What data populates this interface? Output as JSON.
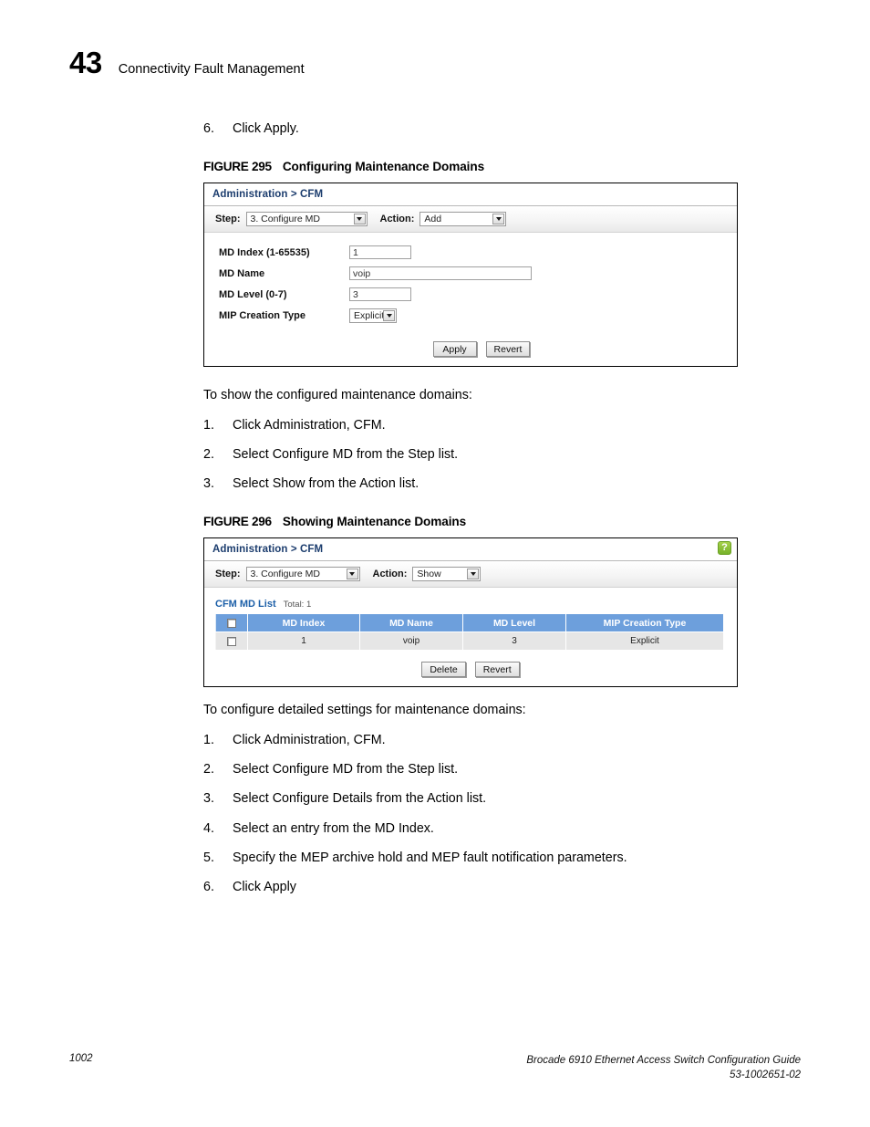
{
  "header": {
    "chapter_number": "43",
    "chapter_title": "Connectivity Fault Management"
  },
  "top_step": {
    "number": "6.",
    "text": "Click Apply."
  },
  "figure_295": {
    "label": "FIGURE 295",
    "title": "Configuring Maintenance Domains",
    "panel": {
      "title": "Administration > CFM",
      "step_label": "Step:",
      "step_value": "3. Configure MD",
      "action_label": "Action:",
      "action_value": "Add",
      "fields": [
        {
          "label": "MD Index (1-65535)",
          "value": "1",
          "type": "text-small"
        },
        {
          "label": "MD Name",
          "value": "voip",
          "type": "text-wide"
        },
        {
          "label": "MD Level (0-7)",
          "value": "3",
          "type": "text-small"
        },
        {
          "label": "MIP Creation Type",
          "value": "Explicit",
          "type": "select"
        }
      ],
      "buttons": [
        {
          "label": "Apply"
        },
        {
          "label": "Revert"
        }
      ]
    }
  },
  "mid_section": {
    "lead": "To show the configured maintenance domains:",
    "steps": [
      {
        "number": "1.",
        "text": "Click Administration, CFM."
      },
      {
        "number": "2.",
        "text": "Select Configure MD from the Step list."
      },
      {
        "number": "3.",
        "text": "Select Show from the Action list."
      }
    ]
  },
  "figure_296": {
    "label": "FIGURE 296",
    "title": "Showing Maintenance Domains",
    "panel": {
      "title": "Administration > CFM",
      "help_icon": "?",
      "step_label": "Step:",
      "step_value": "3. Configure MD",
      "action_label": "Action:",
      "action_value": "Show",
      "list_title": "CFM MD List",
      "list_total": "Total: 1",
      "table": {
        "columns": [
          "",
          "MD Index",
          "MD Name",
          "MD Level",
          "MIP Creation Type"
        ],
        "rows": [
          {
            "checked": false,
            "cells": [
              "1",
              "voip",
              "3",
              "Explicit"
            ]
          }
        ]
      },
      "buttons": [
        {
          "label": "Delete"
        },
        {
          "label": "Revert"
        }
      ]
    }
  },
  "bottom_section": {
    "lead": "To configure detailed settings for maintenance domains:",
    "steps": [
      {
        "number": "1.",
        "text": "Click Administration, CFM."
      },
      {
        "number": "2.",
        "text": "Select Configure MD from the Step list."
      },
      {
        "number": "3.",
        "text": "Select Configure Details from the Action list."
      },
      {
        "number": "4.",
        "text": "Select an entry from the MD Index."
      },
      {
        "number": "5.",
        "text": "Specify the MEP archive hold and MEP fault notification parameters."
      },
      {
        "number": "6.",
        "text": "Click Apply"
      }
    ]
  },
  "footer": {
    "page_number": "1002",
    "guide_title": "Brocade 6910 Ethernet Access Switch Configuration Guide",
    "document_number": "53-1002651-02"
  }
}
